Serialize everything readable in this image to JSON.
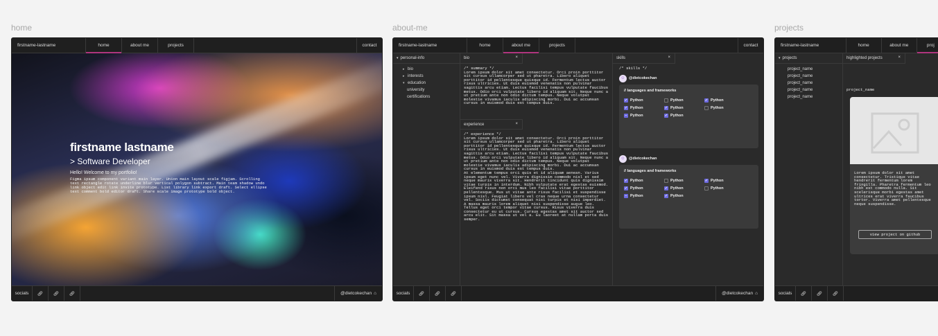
{
  "frames": {
    "home": {
      "label": "home",
      "brand": "firstname-lastname",
      "tabs": [
        "home",
        "about me",
        "projects"
      ],
      "contact": "contact",
      "hero": {
        "name": "firstname lastname",
        "role": "> Software Developer",
        "welcome": "Hello! Welcome to my portfolio!",
        "blurb": "Figma ipsum component variant main layer. Union main layout scale figjam. Scrolling text rectangle rotate underline blur vertical polygon subtract. Main team shadow undo link object edit link invite prototype. List library link export draft. Select ellipse text comment bold editor draft. Share scale image prototype bold object."
      },
      "socials": "socials",
      "handle": "@dietcokechan"
    },
    "about": {
      "label": "about-me",
      "brand": "firstname-lastname",
      "tabs": [
        "home",
        "about me",
        "projects"
      ],
      "contact": "contact",
      "sidebar_header": "personal-info",
      "tree": [
        "bio",
        "interests",
        "education",
        "university",
        "certifications"
      ],
      "bio_tab": "bio",
      "bio_text": "/* summary */\nLorem ipsum dolor sit amet consectetur. Orci proin porttitor sit cursus ullamcorper sed ut pharetra. Libero aliquet porttitor id pellentesque quisque id. Fermentum lectus auctor risus ultricies. Ut duis euismod venenatis non pulvinar sagittis arcu etiam. Lectus facilisi tempus vulputate faucibus metus. Odio orci vulputate libero id aliquam sit. Neque nunc a ut pretium ante non odio dictum tempus. Neque volutpat molestie vivamus iaculis adipiscing morbi. Dui ac accumsan cursus in euismod duis est tempus duis.",
      "experience_tab": "experience",
      "experience_text": "/* experience */\nLorem ipsum dolor sit amet consectetur. Orci proin porttitor sit cursus ullamcorper sed ut pharetra. Libero aliquet porttitor id pellentesque quisque id. Fermentum lectus auctor risus ultricies. Ut duis euismod venenatis non pulvinar sagittis arcu etiam. Lectus facilisi tempus vulputate faucibus metus. Odio orci vulputate libero id aliquam sit. Neque nunc a ut pretium ante non odio dictum tempus. Neque volutpat molestie vivamus iaculis adipiscing morbi. Dui ac accumsan cursus in euismod duis est tempus duis.\nAt elementum tempus orci quis et id aliquam aenean. Varius ipsum eget nunc vel. Viverra dignissim commodo nisl et sed neque mauris viverra sit. Hendrerit tincidunt quis dignissim vitae turpis in interdum. Nibh vulputate erat egestas euismod. Eleifend risus non orci mus leo facilisi vitae porttitor pellentesque. Mus ut vitae ante risus facilisi et suspendisse ipsum nisl. Feugiat libero vel cras neque urna consectetur vel. Sociis dictumst consequat nisi turpis et nisi imperdiet. A massa mauris lorem aliquet nisi suspendisse augue leo. Tellus eget orci tempor vitae cursus. Risus viverra duis consectetur eu ut cursus. Cursus egestas amet sit auctor sed arcu elit. Sit massa ut vel a. Eu laoreet at nullam porta duis semper.",
      "skills_tab": "skills",
      "skills_comment": "/* skills */",
      "skill_user": "@dietcokechan",
      "skill_title": "// languages and frameworks",
      "skill_label": "Python",
      "socials": "socials",
      "handle": "@dietcokechan"
    },
    "projects": {
      "label": "projects",
      "brand": "firstname-lastname",
      "tabs": [
        "home",
        "about me",
        "proj"
      ],
      "sidebar_header": "projects",
      "items": [
        "project_name",
        "project_name",
        "project_name",
        "project_name",
        "project_name"
      ],
      "highlight_tab": "highlighted projects",
      "project_name": "project_name",
      "project_desc": "Lorem ipsum dolor sit amet consectetur. Tristique vitae hendrerit fermentum lorem fringilla. Pharetra fermentum leo nibh est commodo nulla. Sit scelerisque morbi egestas amet ultrices erat viverra faucibus tortor. Viverra amet pellentesque neque suspendisse.",
      "github_button": "view project on github",
      "socials": "socials"
    }
  },
  "colors": {
    "accent": "#b0357e",
    "checkbox": "#6d6adf",
    "panel": "#2a2a2a",
    "bar": "#1f1f1f"
  }
}
